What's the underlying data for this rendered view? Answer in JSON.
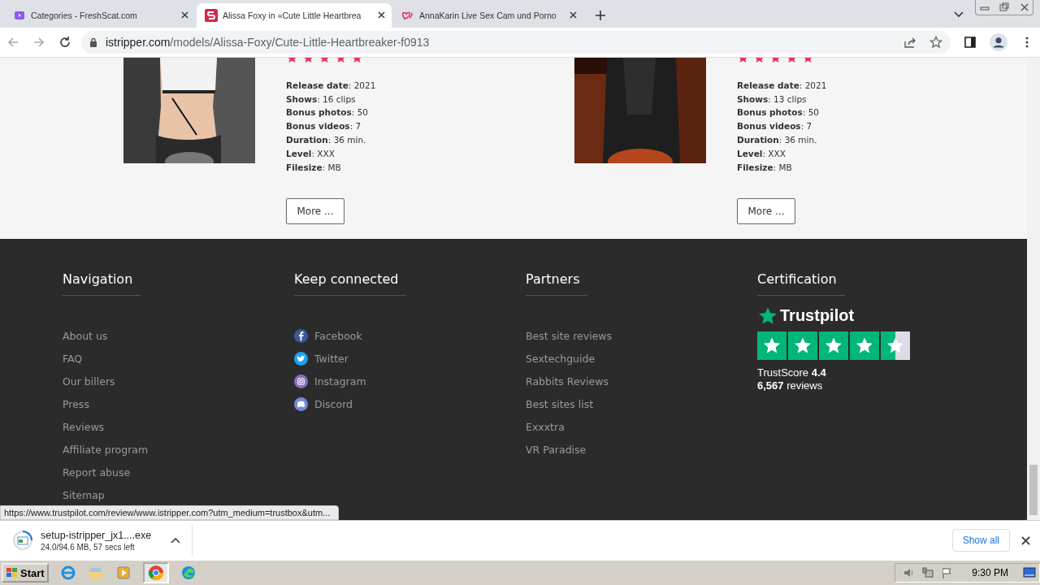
{
  "browser": {
    "tabs": [
      {
        "title": "Categories - FreshScat.com",
        "kind": "square",
        "selected": false
      },
      {
        "title": "Alissa Foxy in «Cute Little Heartbrea",
        "kind": "s-logo",
        "selected": true
      },
      {
        "title": "AnnaKarin Live Sex Cam und Porno",
        "kind": "hearts",
        "selected": false
      }
    ],
    "address": {
      "domain": "istripper.com",
      "path": "/models/Alissa-Foxy/Cute-Little-Heartbreaker-f0913"
    }
  },
  "cards": [
    {
      "stars": 5,
      "details": [
        "**Release date**: 2021",
        "**Shows**: 16 clips",
        "**Bonus photos**: 50",
        "**Bonus videos**: 7",
        "**Duration**: 36 min.",
        "**Level**: XXX",
        "**Filesize**: MB"
      ],
      "button": "More ..."
    },
    {
      "stars": 5,
      "details": [
        "**Release date**: 2021",
        "**Shows**: 13 clips",
        "**Bonus photos**: 50",
        "**Bonus videos**: 7",
        "**Duration**: 36 min.",
        "**Level**: XXX",
        "**Filesize**: MB"
      ],
      "button": "More ..."
    }
  ],
  "footer": {
    "navigation": {
      "heading": "Navigation",
      "links": [
        "About us",
        "FAQ",
        "Our billers",
        "Press",
        "Reviews",
        "Affiliate program",
        "Report abuse",
        "Sitemap"
      ]
    },
    "keep_connected": {
      "heading": "Keep connected",
      "links": [
        {
          "label": "Facebook",
          "kind": "facebook"
        },
        {
          "label": "Twitter",
          "kind": "twitter"
        },
        {
          "label": "Instagram",
          "kind": "instagram"
        },
        {
          "label": "Discord",
          "kind": "discord"
        }
      ]
    },
    "partners": {
      "heading": "Partners",
      "links": [
        "Best site reviews",
        "Sextechguide",
        "Rabbits Reviews",
        "Best sites list",
        "Exxxtra",
        "VR Paradise"
      ]
    },
    "certification": {
      "heading": "Certification",
      "brand": "Trustpilot",
      "score_line": "TrustScore **4.4**",
      "reviews_line": "**6,567** reviews"
    }
  },
  "status_url": "https://www.trustpilot.com/review/www.istripper.com?utm_medium=trustbox&utm...",
  "download": {
    "filename": "setup-istripper_jx1....exe",
    "progress": "24.0/94.6 MB, 57 secs left",
    "show_all": "Show all"
  },
  "taskbar": {
    "start": "Start",
    "clock": "9:30 PM"
  }
}
